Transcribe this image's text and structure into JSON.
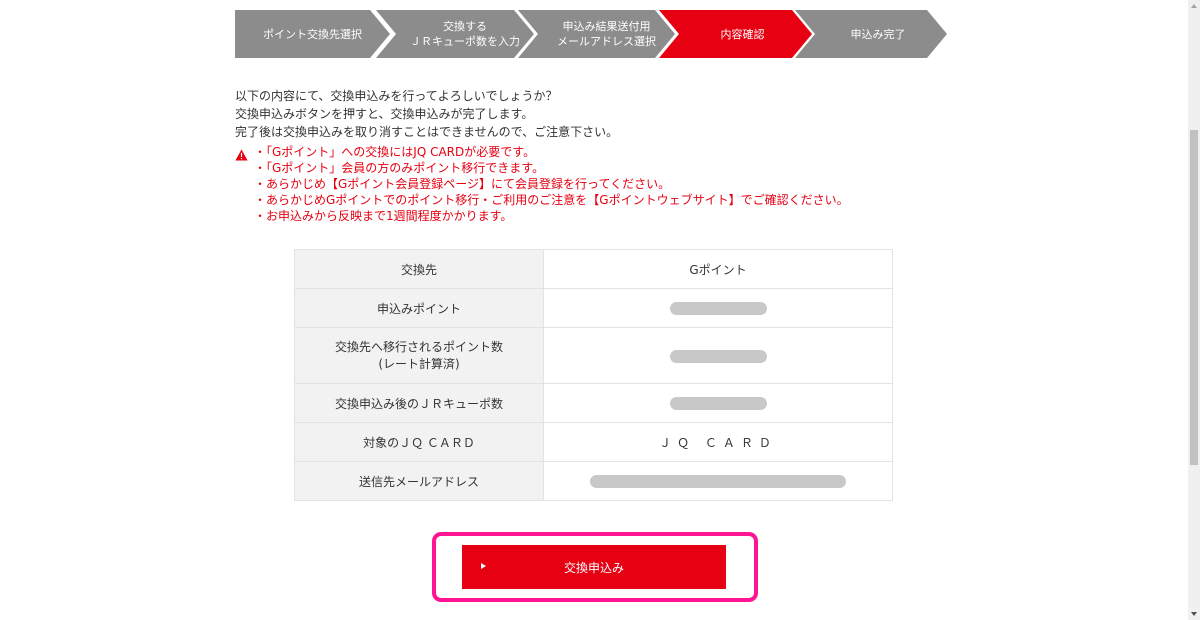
{
  "steps": [
    {
      "label": "ポイント交換先選択",
      "active": false
    },
    {
      "label": "交換する\nＪＲキューポ数を入力",
      "active": false
    },
    {
      "label": "申込み結果送付用\nメールアドレス選択",
      "active": false
    },
    {
      "label": "内容確認",
      "active": true
    },
    {
      "label": "申込み完了",
      "active": false
    }
  ],
  "intro": {
    "line1": "以下の内容にて、交換申込みを行ってよろしいでしょうか？",
    "line2": "交換申込みボタンを押すと、交換申込みが完了します。",
    "line3": "完了後は交換申込みを取り消すことはできませんので、ご注意下さい。"
  },
  "warnings": [
    "・「Gポイント」への交換にはJQ CARDが必要です。",
    "・「Gポイント」会員の方のみポイント移行できます。",
    "・あらかじめ【Gポイント会員登録ページ】にて会員登録を行ってください。",
    "・あらかじめGポイントでのポイント移行・ご利用のご注意を【Gポイントウェブサイト】でご確認ください。",
    "・お申込みから反映まで1週間程度かかります。"
  ],
  "table": {
    "exchange_to_label": "交換先",
    "exchange_to_value": "Gポイント",
    "apply_points_label": "申込みポイント",
    "transfer_points_label_1": "交換先へ移行されるポイント数",
    "transfer_points_label_2": "(レート計算済)",
    "remaining_label": "交換申込み後のＪＲキューポ数",
    "card_label": "対象のＪＱ ＣＡＲＤ",
    "card_value": "ＪＱ ＣＡＲＤ",
    "email_label": "送信先メールアドレス"
  },
  "submit": {
    "label": "交換申込み"
  },
  "colors": {
    "accent": "#e60012",
    "step_inactive": "#8c8c8c",
    "highlight": "#ff1493"
  }
}
